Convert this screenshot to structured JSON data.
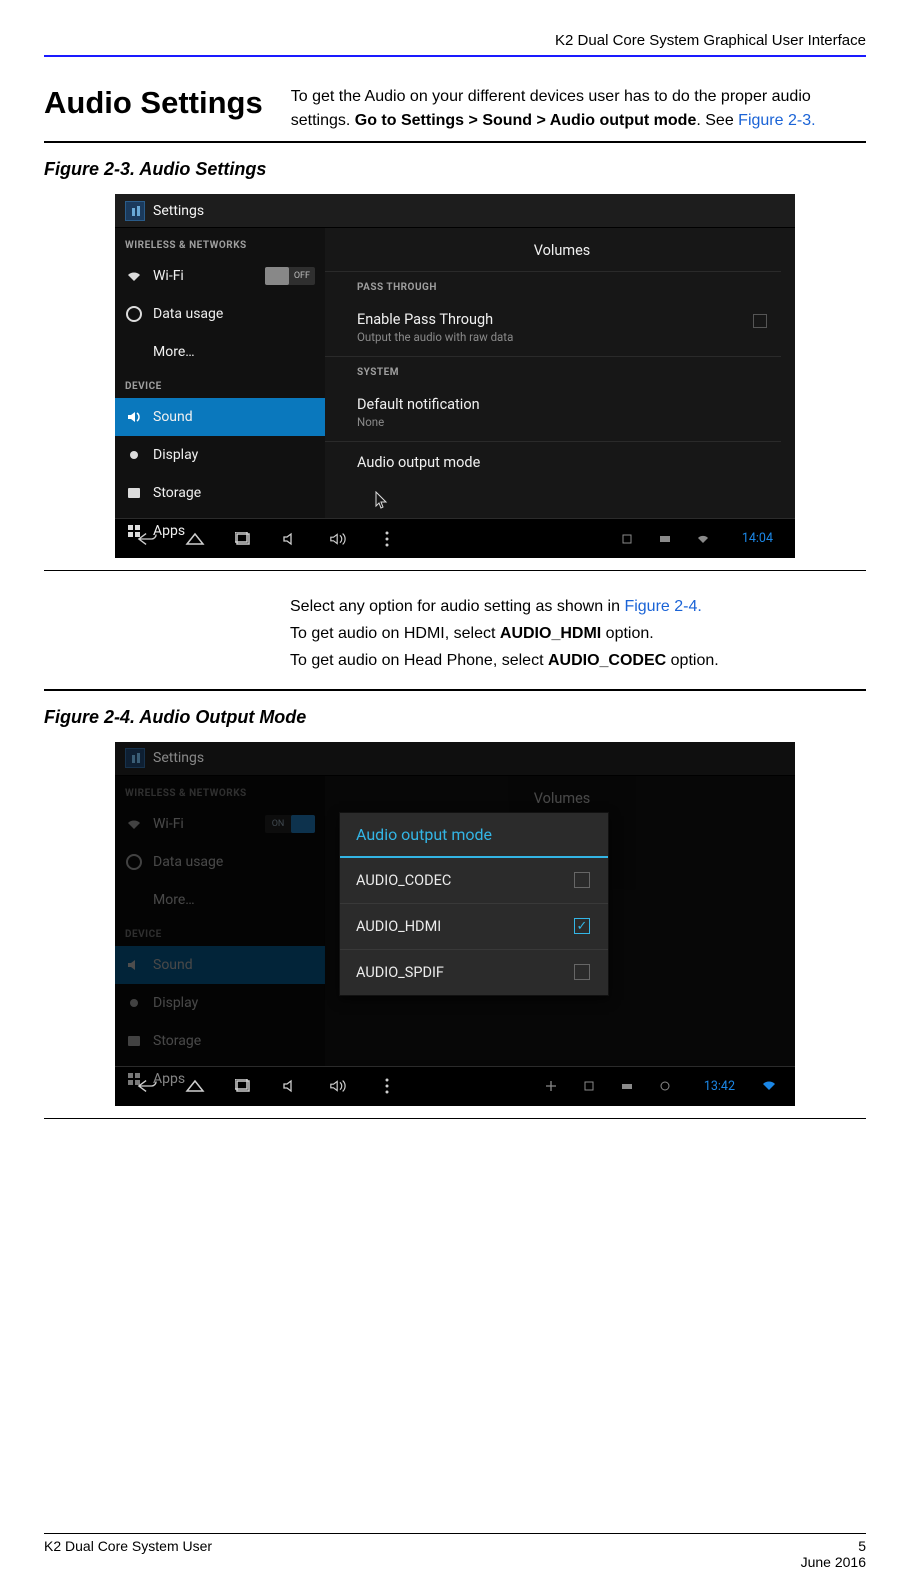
{
  "header": {
    "title": "K2 Dual Core System Graphical User Interface"
  },
  "section1": {
    "title": "Audio Settings",
    "text_a": "To get the Audio on your different devices user has to do the proper audio settings. ",
    "text_bold": "Go to Settings > Sound > Audio output mode",
    "text_b": ". See ",
    "link": "Figure 2-3."
  },
  "fig23": {
    "caption": "Figure 2-3. Audio Settings",
    "shot": {
      "app_title": "Settings",
      "left": {
        "cat1": "WIRELESS & NETWORKS",
        "wifi": "Wi-Fi",
        "wifi_toggle": "OFF",
        "data": "Data usage",
        "more": "More…",
        "cat2": "DEVICE",
        "sound": "Sound",
        "display": "Display",
        "storage": "Storage",
        "apps": "Apps"
      },
      "right": {
        "volumes": "Volumes",
        "cat_pt": "PASS THROUGH",
        "ept": "Enable Pass Through",
        "ept_sub": "Output the audio with raw data",
        "cat_sys": "SYSTEM",
        "defnot": "Default notification",
        "defnot_sub": "None",
        "aom": "Audio output mode"
      },
      "clock": "14:04"
    }
  },
  "midtext": {
    "l1a": "Select any option for audio setting as shown in ",
    "l1_link": "Figure 2-4.",
    "l2a": "To get audio on HDMI, select ",
    "l2_bold": "AUDIO_HDMI",
    "l2b": " option.",
    "l3a": "To get audio on Head Phone, select ",
    "l3_bold": "AUDIO_CODEC",
    "l3b": " option."
  },
  "fig24": {
    "caption": "Figure 2-4. Audio Output Mode",
    "shot": {
      "app_title": "Settings",
      "left": {
        "cat1": "WIRELESS & NETWORKS",
        "wifi": "Wi-Fi",
        "wifi_toggle": "ON",
        "data": "Data usage",
        "more": "More…",
        "cat2": "DEVICE",
        "sound": "Sound",
        "display": "Display",
        "storage": "Storage",
        "apps": "Apps"
      },
      "right": {
        "volumes": "Volumes"
      },
      "dialog": {
        "title": "Audio output mode",
        "opt1": "AUDIO_CODEC",
        "opt2": "AUDIO_HDMI",
        "opt3": "AUDIO_SPDIF"
      },
      "clock": "13:42"
    }
  },
  "footer": {
    "left": "K2 Dual Core System User",
    "right_num": "5",
    "right_date": "June 2016"
  }
}
